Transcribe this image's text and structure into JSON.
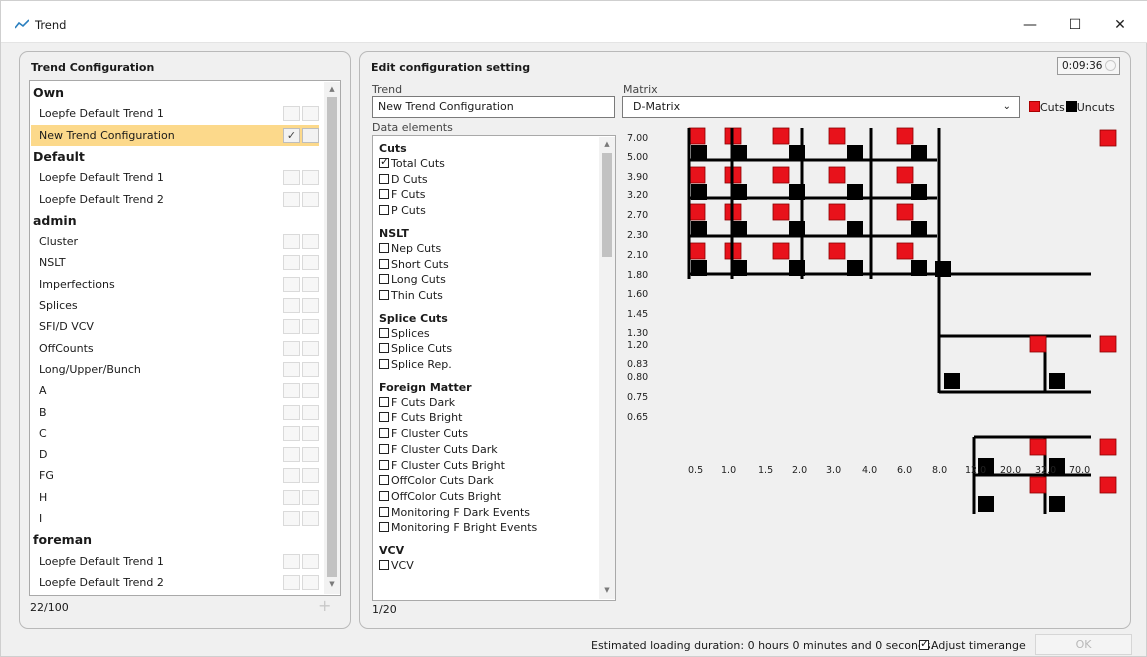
{
  "window": {
    "title": "Trend",
    "minimize": "—",
    "maximize": "☐",
    "close": "✕"
  },
  "left": {
    "title": "Trend Configuration",
    "rows": [
      {
        "label": "Own",
        "type": "header"
      },
      {
        "label": "Loepfe Default Trend 1",
        "type": "item"
      },
      {
        "label": "New Trend Configuration",
        "type": "item",
        "selected": true
      },
      {
        "label": "Default",
        "type": "header"
      },
      {
        "label": "Loepfe Default Trend 1",
        "type": "item"
      },
      {
        "label": "Loepfe Default Trend 2",
        "type": "item"
      },
      {
        "label": "admin",
        "type": "header"
      },
      {
        "label": "Cluster",
        "type": "item"
      },
      {
        "label": "NSLT",
        "type": "item"
      },
      {
        "label": "Imperfections",
        "type": "item"
      },
      {
        "label": "Splices",
        "type": "item"
      },
      {
        "label": "SFI/D VCV",
        "type": "item"
      },
      {
        "label": "OffCounts",
        "type": "item"
      },
      {
        "label": "Long/Upper/Bunch",
        "type": "item"
      },
      {
        "label": "A",
        "type": "item"
      },
      {
        "label": "B",
        "type": "item"
      },
      {
        "label": "C",
        "type": "item"
      },
      {
        "label": "D",
        "type": "item"
      },
      {
        "label": "FG",
        "type": "item"
      },
      {
        "label": "H",
        "type": "item"
      },
      {
        "label": "I",
        "type": "item"
      },
      {
        "label": "foreman",
        "type": "header"
      },
      {
        "label": "Loepfe Default Trend 1",
        "type": "item"
      },
      {
        "label": "Loepfe Default Trend 2",
        "type": "item"
      }
    ],
    "count": "22/100",
    "add": "+"
  },
  "right": {
    "title": "Edit configuration setting",
    "timer": "0:09:36",
    "trend_label": "Trend",
    "trend_value": "New Trend Configuration",
    "data_elements_label": "Data elements",
    "matrix_label": "Matrix",
    "matrix_value": "D-Matrix",
    "legend_cuts": "Cuts",
    "legend_uncuts": "Uncuts",
    "cuts_color": "#e8121b",
    "uncuts_color": "#000000",
    "elements_count": "1/20",
    "groups": [
      {
        "name": "Cuts",
        "items": [
          {
            "label": "Total Cuts",
            "checked": true
          },
          {
            "label": "D Cuts"
          },
          {
            "label": "F Cuts"
          },
          {
            "label": "P Cuts"
          }
        ]
      },
      {
        "name": "NSLT",
        "items": [
          {
            "label": "Nep Cuts"
          },
          {
            "label": "Short Cuts"
          },
          {
            "label": "Long Cuts"
          },
          {
            "label": "Thin Cuts"
          }
        ]
      },
      {
        "name": "Splice Cuts",
        "items": [
          {
            "label": "Splices"
          },
          {
            "label": "Splice Cuts"
          },
          {
            "label": "Splice Rep."
          }
        ]
      },
      {
        "name": "Foreign Matter",
        "items": [
          {
            "label": "F Cuts Dark"
          },
          {
            "label": "F Cuts Bright"
          },
          {
            "label": "F Cluster Cuts"
          },
          {
            "label": "F Cluster Cuts Dark"
          },
          {
            "label": "F Cluster Cuts Bright"
          },
          {
            "label": "OffColor Cuts Dark"
          },
          {
            "label": "OffColor Cuts Bright"
          },
          {
            "label": "Monitoring F Dark Events"
          },
          {
            "label": "Monitoring F Bright Events"
          }
        ]
      },
      {
        "name": "VCV",
        "items": [
          {
            "label": "VCV"
          }
        ]
      }
    ],
    "y_labels": [
      "7.00",
      "5.00",
      "3.90",
      "3.20",
      "2.70",
      "2.30",
      "2.10",
      "1.80",
      "1.60",
      "1.45",
      "1.30",
      "1.20",
      "0.83",
      "0.80",
      "0.75",
      "0.65"
    ],
    "x_labels": [
      "0.5",
      "1.0",
      "1.5",
      "2.0",
      "3.0",
      "4.0",
      "6.0",
      "8.0",
      "12.0",
      "20.0",
      "32.0",
      "70.0"
    ]
  },
  "footer": {
    "estimate": "Estimated loading duration: 0 hours 0 minutes and 0 seconds.",
    "adjust": "Adjust timerange",
    "ok": "OK"
  }
}
